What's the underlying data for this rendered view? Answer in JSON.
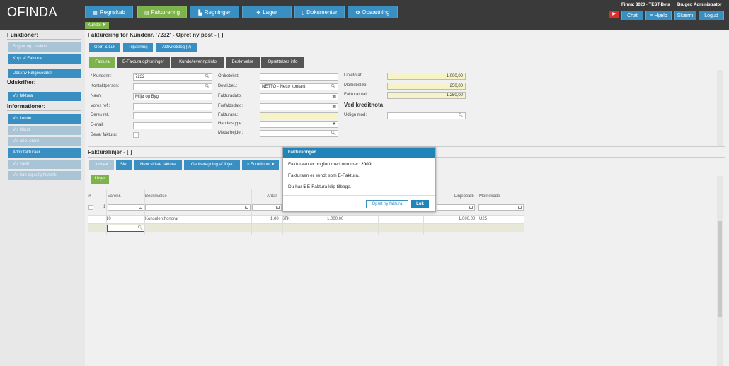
{
  "app": {
    "logo": "OFINDA"
  },
  "nav": [
    {
      "label": "Regnskab",
      "icon": "calculator-icon",
      "glyph": "▦"
    },
    {
      "label": "Fakturering",
      "icon": "invoice-icon",
      "glyph": "▤"
    },
    {
      "label": "Regninger",
      "icon": "bills-icon",
      "glyph": "▙"
    },
    {
      "label": "Lager",
      "icon": "warehouse-icon",
      "glyph": "✤"
    },
    {
      "label": "Dokumenter",
      "icon": "document-icon",
      "glyph": "▯"
    },
    {
      "label": "Opsætning",
      "icon": "gear-icon",
      "glyph": "✿"
    }
  ],
  "user": {
    "firma": "Firma: 8020 - TEST-Beta",
    "bruger": "Bruger: Administrator"
  },
  "topbuttons": {
    "chat": "Chat",
    "help": "≡ Hjælp",
    "screen": "Skærm",
    "logout": "Logud"
  },
  "tabs": {
    "kunder": "Kunder ✖"
  },
  "sidebar": {
    "funktioner": "Funktioner:",
    "f1": "Bogfør og Udskriv",
    "f2": "Kopi af Faktura",
    "f3": "Udskriv Følgeseddel",
    "udskrifter": "Udskrifter:",
    "u1": "Vis faktura",
    "informationer": "Informationer:",
    "i1": "Vis kunde",
    "i2": "Vis tilbud",
    "i3": "Vis abb. ordre",
    "i4": "Arkiv fakturaer",
    "i5": "Vis varer",
    "i6": "Vis køb og salg historik"
  },
  "page": {
    "title": "Fakturering for Kundenr. '7232' - Opret ny post - [ ]",
    "btn_gem": "Gem & Luk",
    "btn_tilpasning": "Tilpasning",
    "btn_aktivitet": "Aktivitetslog (0)"
  },
  "subtabs": {
    "faktura": "Faktura",
    "efaktura": "E-Faktura oplysninger",
    "kunde": "Kunde/leveringsinfo",
    "beskrivelse": "Beskrivelse",
    "oprettelse": "Oprettelses info"
  },
  "form": {
    "kundenr_label": "Kundenr.:",
    "kundenr": "7232",
    "kontakt_label": "Kontaktperson:",
    "navn_label": "Navn:",
    "navn": "Miljø og Byg",
    "vores_label": "Vores ref.:",
    "deres_label": "Deres ref.:",
    "email_label": "E-mail:",
    "bevar_label": "Bevar faktura:",
    "ordretekst_label": "Ordretekst:",
    "betal_label": "Betal.bet.:",
    "betal": "NETTO - Netto kontant",
    "fakturadato_label": "Fakturadato:",
    "forfald_label": "Forfaldsdato:",
    "fakturanr_label": "Fakturanr.:",
    "handel_label": "Handelstype:",
    "medarb_label": "Medarbejder:",
    "linjetotal_label": "Linjetotal:",
    "linjetotal": "1.000,00",
    "moms_label": "Momsbeløb:",
    "moms": "250,00",
    "fakturatotal_label": "Fakturatotal:",
    "fakturatotal": "1.250,00",
    "kredit_title": "Ved kreditnota",
    "udlign_label": "Udlign mod:"
  },
  "lines": {
    "title": "Fakturalinjer - [ ]",
    "btn_indsaet": "Indsæt",
    "btn_slet": "Slet",
    "btn_hent": "Hent sidste faktura",
    "btn_genberegn": "Genberegning af linjer",
    "btn_funktioner": "≡ Funktioner ▾",
    "btn_linjer": "Linjer",
    "col_hash": "#",
    "col_varenr": "Varenr.",
    "col_beskrivelse": "Beskrivelse",
    "col_antal": "Antal",
    "col_linjebelob": "Linjebeløb",
    "col_momskode": "Momskode",
    "filter_num": "1",
    "row": {
      "varenr": "10",
      "beskrivelse": "Konsulenthonorar",
      "antal": "1,00",
      "enhed": "STK",
      "pris": "1.000,00",
      "linjebelob": "1.000,00",
      "momskode": "U25"
    }
  },
  "modal": {
    "title": "Faktureringen",
    "line1_pre": "Fakturaen er bogført med nummer: ",
    "line1_num": "2000",
    "line2": "Fakturaen er sendt som E-Faktura.",
    "line3_pre": "Du har ",
    "line3_num": "5",
    "line3_post": " E-Faktura klip tilbage.",
    "btn_opret": "Opret ny faktura",
    "btn_luk": "Luk"
  },
  "colors": {
    "blue": "#3a8fc2",
    "green": "#7eb34b",
    "modal_head": "#1f84b8",
    "topbar": "#3a3a3a"
  }
}
